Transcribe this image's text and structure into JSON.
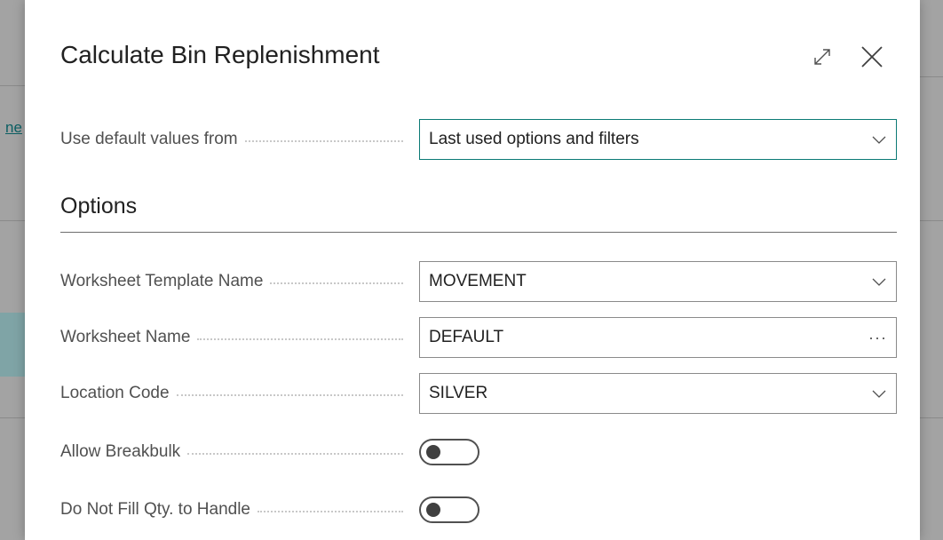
{
  "background": {
    "link_fragment": "ne"
  },
  "dialog": {
    "title": "Calculate Bin Replenishment",
    "default_values": {
      "label": "Use default values from",
      "value": "Last used options and filters"
    },
    "options_section": {
      "title": "Options",
      "fields": {
        "worksheet_template_name": {
          "label": "Worksheet Template Name",
          "value": "MOVEMENT"
        },
        "worksheet_name": {
          "label": "Worksheet Name",
          "value": "DEFAULT",
          "lookup": "···"
        },
        "location_code": {
          "label": "Location Code",
          "value": "SILVER"
        },
        "allow_breakbulk": {
          "label": "Allow Breakbulk",
          "value": false
        },
        "do_not_fill_qty": {
          "label": "Do Not Fill Qty. to Handle",
          "value": false
        }
      }
    }
  },
  "icons": {
    "expand": "expand-icon",
    "close": "close-icon",
    "dropdown": "chevron-down-icon"
  },
  "colors": {
    "accent": "#0b7a75",
    "link": "#0b5f63"
  }
}
